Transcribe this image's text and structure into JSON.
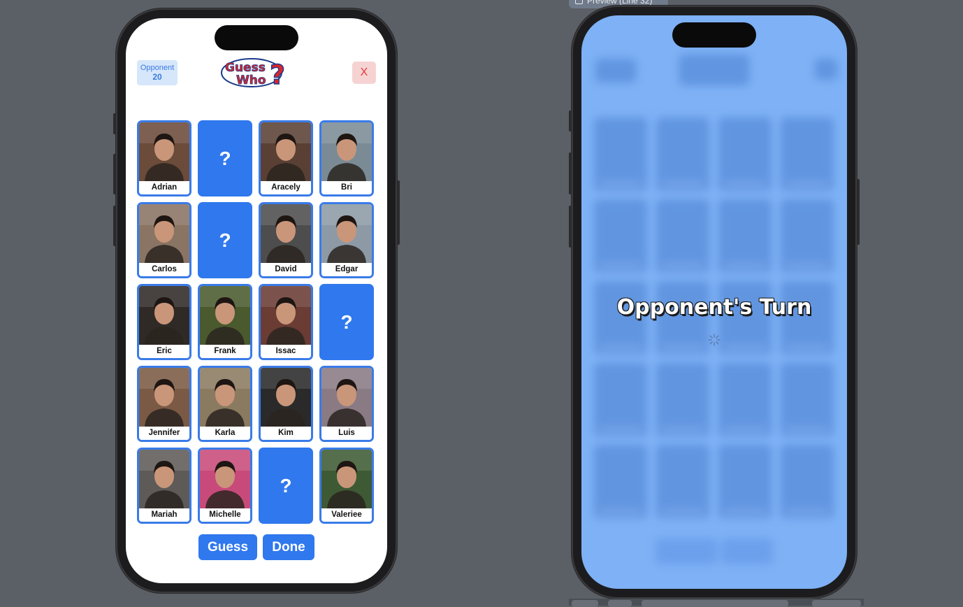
{
  "preview": {
    "label": "Preview (Line 32)"
  },
  "left_phone": {
    "opponent_badge": {
      "label": "Opponent",
      "count": "20"
    },
    "logo": {
      "line1": "Guess",
      "line2": "Who",
      "mark": "?"
    },
    "close_label": "X",
    "cards": [
      {
        "name": "Adrian",
        "hidden": false,
        "bg": "#6b4b3a"
      },
      {
        "name": "",
        "hidden": true
      },
      {
        "name": "Aracely",
        "hidden": false,
        "bg": "#5a4034"
      },
      {
        "name": "Bri",
        "hidden": false,
        "bg": "#7a8b96"
      },
      {
        "name": "Carlos",
        "hidden": false,
        "bg": "#8a7464"
      },
      {
        "name": "",
        "hidden": true
      },
      {
        "name": "David",
        "hidden": false,
        "bg": "#4d4d4d"
      },
      {
        "name": "Edgar",
        "hidden": false,
        "bg": "#8d9aa6"
      },
      {
        "name": "Eric",
        "hidden": false,
        "bg": "#2f2a26"
      },
      {
        "name": "Frank",
        "hidden": false,
        "bg": "#4a5a2e"
      },
      {
        "name": "Issac",
        "hidden": false,
        "bg": "#6a3c34"
      },
      {
        "name": "",
        "hidden": true
      },
      {
        "name": "Jennifer",
        "hidden": false,
        "bg": "#7a5a44"
      },
      {
        "name": "Karla",
        "hidden": false,
        "bg": "#8a7a60"
      },
      {
        "name": "Kim",
        "hidden": false,
        "bg": "#2a2a2a"
      },
      {
        "name": "Luis",
        "hidden": false,
        "bg": "#8a7a84"
      },
      {
        "name": "Mariah",
        "hidden": false,
        "bg": "#5e5a58"
      },
      {
        "name": "Michelle",
        "hidden": false,
        "bg": "#c84a7a"
      },
      {
        "name": "",
        "hidden": true
      },
      {
        "name": "Valeriee",
        "hidden": false,
        "bg": "#3e5a34"
      }
    ],
    "hidden_mark": "?",
    "buttons": {
      "guess": "Guess",
      "done": "Done"
    }
  },
  "right_phone": {
    "overlay_text": "Opponent's Turn",
    "spinner": "loading-spinner-icon"
  },
  "colors": {
    "accent": "#2f78ee",
    "card_border": "#3a7be8",
    "overlay": "#7eb1f5",
    "close_bg": "#f6d3d3",
    "close_fg": "#e23b3b"
  }
}
